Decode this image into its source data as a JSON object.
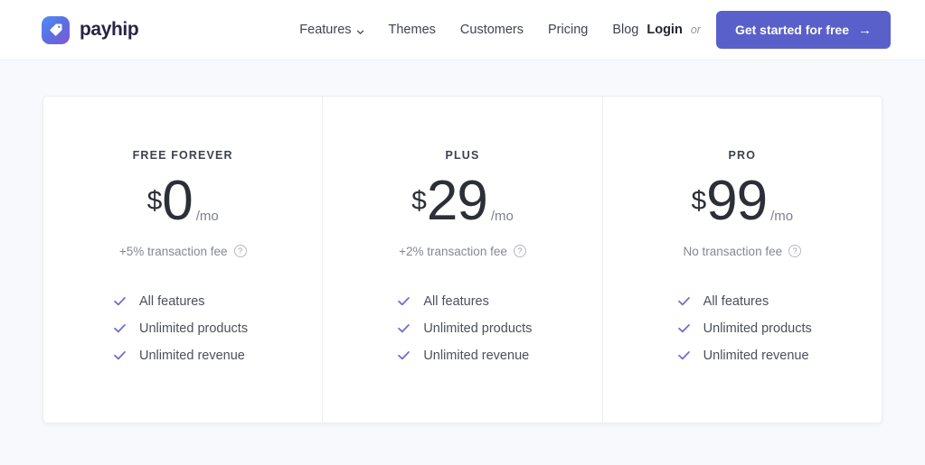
{
  "header": {
    "brand": {
      "name": "payhip",
      "logo_icon": "price-tag-icon"
    },
    "nav": [
      {
        "label": "Features",
        "has_dropdown": true
      },
      {
        "label": "Themes",
        "has_dropdown": false
      },
      {
        "label": "Customers",
        "has_dropdown": false
      },
      {
        "label": "Pricing",
        "has_dropdown": false
      },
      {
        "label": "Blog",
        "has_dropdown": false
      }
    ],
    "login_label": "Login",
    "or_label": "or",
    "cta_label": "Get started for free",
    "cta_arrow": "→",
    "cta_color": "#5a60c9"
  },
  "pricing": {
    "check_color": "#6f6ad4",
    "plans": [
      {
        "name": "FREE FOREVER",
        "currency": "$",
        "amount": "0",
        "period": "/mo",
        "fee_label": "+5% transaction fee",
        "features": [
          "All features",
          "Unlimited products",
          "Unlimited revenue"
        ]
      },
      {
        "name": "PLUS",
        "currency": "$",
        "amount": "29",
        "period": "/mo",
        "fee_label": "+2% transaction fee",
        "features": [
          "All features",
          "Unlimited products",
          "Unlimited revenue"
        ]
      },
      {
        "name": "PRO",
        "currency": "$",
        "amount": "99",
        "period": "/mo",
        "fee_label": "No transaction fee",
        "features": [
          "All features",
          "Unlimited products",
          "Unlimited revenue"
        ]
      }
    ]
  }
}
